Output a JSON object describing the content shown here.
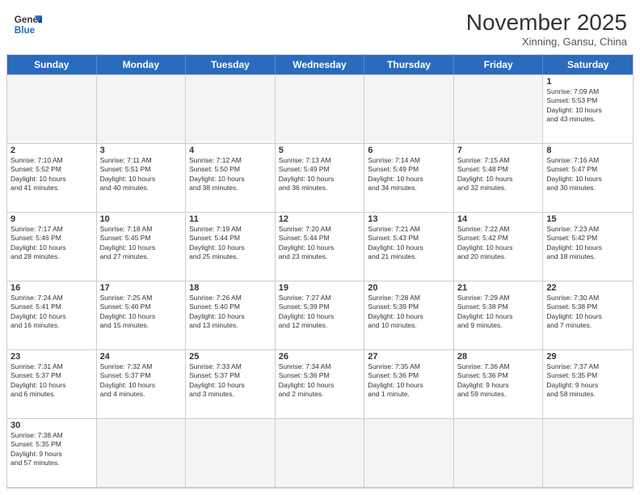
{
  "logo": {
    "general": "General",
    "blue": "Blue"
  },
  "title": "November 2025",
  "subtitle": "Xinning, Gansu, China",
  "header_days": [
    "Sunday",
    "Monday",
    "Tuesday",
    "Wednesday",
    "Thursday",
    "Friday",
    "Saturday"
  ],
  "weeks": [
    [
      {
        "day": "",
        "info": ""
      },
      {
        "day": "",
        "info": ""
      },
      {
        "day": "",
        "info": ""
      },
      {
        "day": "",
        "info": ""
      },
      {
        "day": "",
        "info": ""
      },
      {
        "day": "",
        "info": ""
      },
      {
        "day": "1",
        "info": "Sunrise: 7:09 AM\nSunset: 5:53 PM\nDaylight: 10 hours\nand 43 minutes."
      }
    ],
    [
      {
        "day": "2",
        "info": "Sunrise: 7:10 AM\nSunset: 5:52 PM\nDaylight: 10 hours\nand 41 minutes."
      },
      {
        "day": "3",
        "info": "Sunrise: 7:11 AM\nSunset: 5:51 PM\nDaylight: 10 hours\nand 40 minutes."
      },
      {
        "day": "4",
        "info": "Sunrise: 7:12 AM\nSunset: 5:50 PM\nDaylight: 10 hours\nand 38 minutes."
      },
      {
        "day": "5",
        "info": "Sunrise: 7:13 AM\nSunset: 5:49 PM\nDaylight: 10 hours\nand 36 minutes."
      },
      {
        "day": "6",
        "info": "Sunrise: 7:14 AM\nSunset: 5:49 PM\nDaylight: 10 hours\nand 34 minutes."
      },
      {
        "day": "7",
        "info": "Sunrise: 7:15 AM\nSunset: 5:48 PM\nDaylight: 10 hours\nand 32 minutes."
      },
      {
        "day": "8",
        "info": "Sunrise: 7:16 AM\nSunset: 5:47 PM\nDaylight: 10 hours\nand 30 minutes."
      }
    ],
    [
      {
        "day": "9",
        "info": "Sunrise: 7:17 AM\nSunset: 5:46 PM\nDaylight: 10 hours\nand 28 minutes."
      },
      {
        "day": "10",
        "info": "Sunrise: 7:18 AM\nSunset: 5:45 PM\nDaylight: 10 hours\nand 27 minutes."
      },
      {
        "day": "11",
        "info": "Sunrise: 7:19 AM\nSunset: 5:44 PM\nDaylight: 10 hours\nand 25 minutes."
      },
      {
        "day": "12",
        "info": "Sunrise: 7:20 AM\nSunset: 5:44 PM\nDaylight: 10 hours\nand 23 minutes."
      },
      {
        "day": "13",
        "info": "Sunrise: 7:21 AM\nSunset: 5:43 PM\nDaylight: 10 hours\nand 21 minutes."
      },
      {
        "day": "14",
        "info": "Sunrise: 7:22 AM\nSunset: 5:42 PM\nDaylight: 10 hours\nand 20 minutes."
      },
      {
        "day": "15",
        "info": "Sunrise: 7:23 AM\nSunset: 5:42 PM\nDaylight: 10 hours\nand 18 minutes."
      }
    ],
    [
      {
        "day": "16",
        "info": "Sunrise: 7:24 AM\nSunset: 5:41 PM\nDaylight: 10 hours\nand 16 minutes."
      },
      {
        "day": "17",
        "info": "Sunrise: 7:25 AM\nSunset: 5:40 PM\nDaylight: 10 hours\nand 15 minutes."
      },
      {
        "day": "18",
        "info": "Sunrise: 7:26 AM\nSunset: 5:40 PM\nDaylight: 10 hours\nand 13 minutes."
      },
      {
        "day": "19",
        "info": "Sunrise: 7:27 AM\nSunset: 5:39 PM\nDaylight: 10 hours\nand 12 minutes."
      },
      {
        "day": "20",
        "info": "Sunrise: 7:28 AM\nSunset: 5:39 PM\nDaylight: 10 hours\nand 10 minutes."
      },
      {
        "day": "21",
        "info": "Sunrise: 7:29 AM\nSunset: 5:38 PM\nDaylight: 10 hours\nand 9 minutes."
      },
      {
        "day": "22",
        "info": "Sunrise: 7:30 AM\nSunset: 5:38 PM\nDaylight: 10 hours\nand 7 minutes."
      }
    ],
    [
      {
        "day": "23",
        "info": "Sunrise: 7:31 AM\nSunset: 5:37 PM\nDaylight: 10 hours\nand 6 minutes."
      },
      {
        "day": "24",
        "info": "Sunrise: 7:32 AM\nSunset: 5:37 PM\nDaylight: 10 hours\nand 4 minutes."
      },
      {
        "day": "25",
        "info": "Sunrise: 7:33 AM\nSunset: 5:37 PM\nDaylight: 10 hours\nand 3 minutes."
      },
      {
        "day": "26",
        "info": "Sunrise: 7:34 AM\nSunset: 5:36 PM\nDaylight: 10 hours\nand 2 minutes."
      },
      {
        "day": "27",
        "info": "Sunrise: 7:35 AM\nSunset: 5:36 PM\nDaylight: 10 hours\nand 1 minute."
      },
      {
        "day": "28",
        "info": "Sunrise: 7:36 AM\nSunset: 5:36 PM\nDaylight: 9 hours\nand 59 minutes."
      },
      {
        "day": "29",
        "info": "Sunrise: 7:37 AM\nSunset: 5:35 PM\nDaylight: 9 hours\nand 58 minutes."
      }
    ],
    [
      {
        "day": "30",
        "info": "Sunrise: 7:38 AM\nSunset: 5:35 PM\nDaylight: 9 hours\nand 57 minutes."
      },
      {
        "day": "",
        "info": ""
      },
      {
        "day": "",
        "info": ""
      },
      {
        "day": "",
        "info": ""
      },
      {
        "day": "",
        "info": ""
      },
      {
        "day": "",
        "info": ""
      },
      {
        "day": "",
        "info": ""
      }
    ]
  ]
}
